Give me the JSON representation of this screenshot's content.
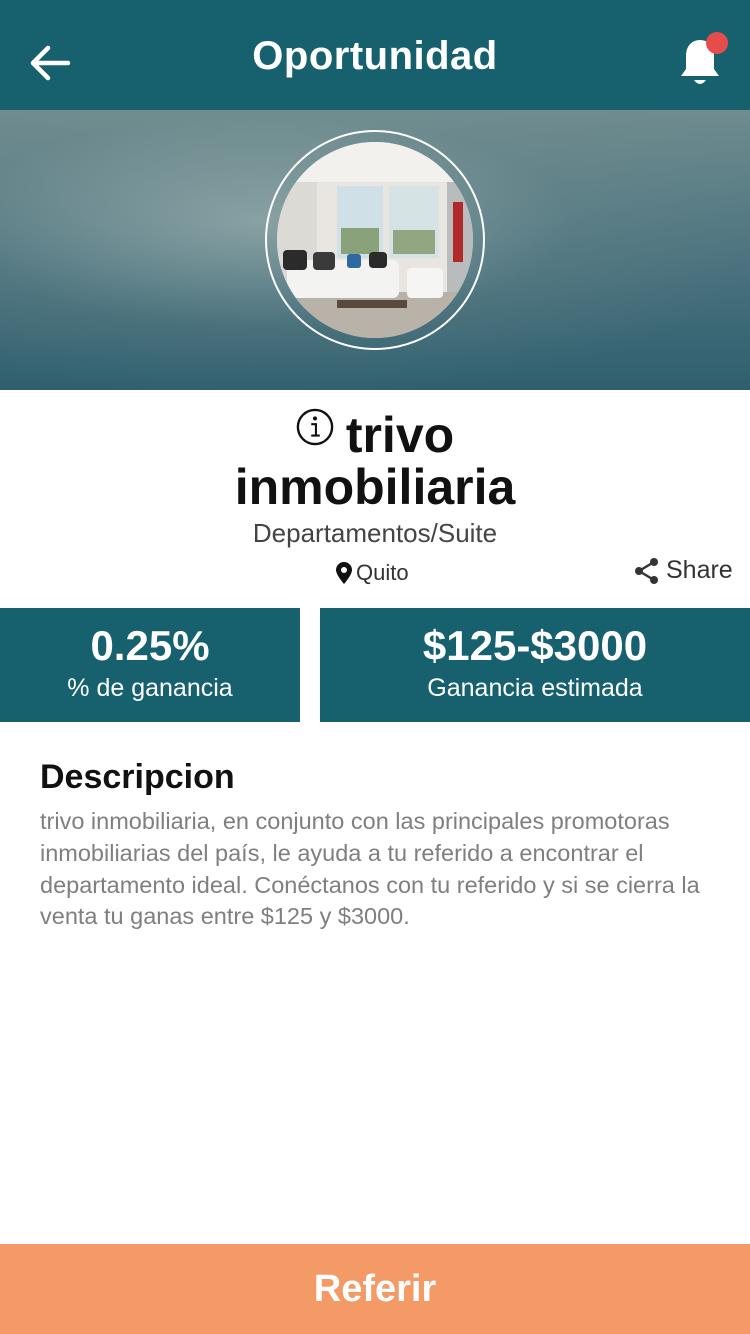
{
  "header": {
    "title": "Oportunidad",
    "back_icon": "arrow-left-icon",
    "notification_icon": "bell-icon",
    "notification_dot_color": "#e74c4c"
  },
  "opportunity": {
    "name_line1": "trivo",
    "name_line2": "inmobiliaria",
    "category": "Departamentos/Suite",
    "location": "Quito",
    "share_label": "Share",
    "info_icon": "info-icon"
  },
  "stats": {
    "commission_value": "0.25%",
    "commission_label": "% de ganancia",
    "earnings_value": "$125-$3000",
    "earnings_label": "Ganancia estimada"
  },
  "description": {
    "title": "Descripcion",
    "text": "trivo inmobiliaria, en conjunto con las principales promotoras inmobiliarias del país,  le ayuda a tu referido a encontrar el departamento ideal. Conéctanos con tu referido y si se cierra la venta tu ganas entre $125 y $3000."
  },
  "cta": {
    "label": "Referir"
  },
  "colors": {
    "primary": "#17616f",
    "accent": "#f49a66"
  }
}
